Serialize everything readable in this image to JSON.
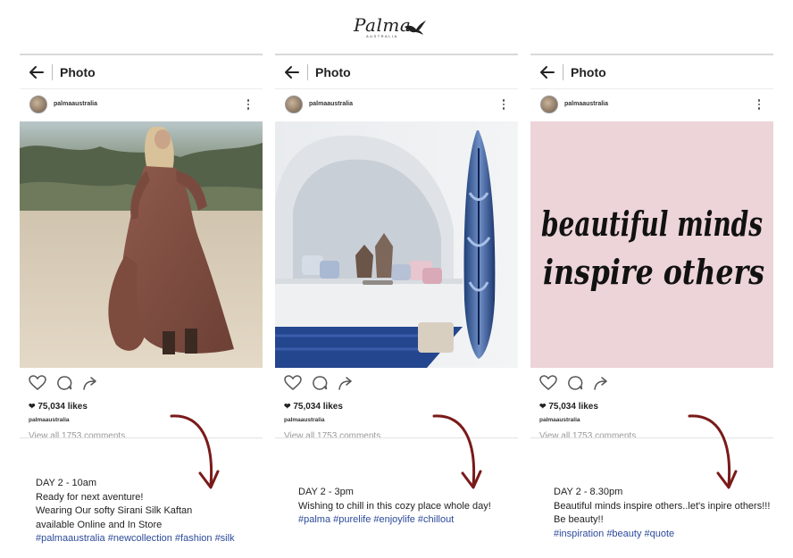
{
  "brand": {
    "logo_text": "Palma",
    "logo_sub": "AUSTRALIA"
  },
  "colors": {
    "arrow": "#7a1a1a",
    "hashtag": "#2c4a9a",
    "card_border": "#d9d9d9"
  },
  "posts": [
    {
      "header_title": "Photo",
      "username": "palmaaustralia",
      "likes": "75,034 likes",
      "poster": "palmaaustralia",
      "view_all": "View all 1753 comments",
      "photo_desc": "woman in flowing rust maxi kaftan dress on sandy beach",
      "caption": {
        "line1": "DAY 2 - 10am",
        "line2": "Ready for next aventure!",
        "line3": "Wearing Our softy Sirani Silk Kaftan",
        "line4": "available Online and In Store",
        "tags": "#palmaaustralia #newcollection #fashion #silk"
      }
    },
    {
      "header_title": "Photo",
      "username": "palmaaustralia",
      "likes": "75,034 likes",
      "poster": "palmaaustralia",
      "view_all": "View all 1753 comments",
      "photo_desc": "white arched nook with cushions, lanterns and a blue tie-dye surfboard",
      "caption": {
        "line1": "DAY 2 - 3pm",
        "line2": "Wishing to chill in this cozy place whole day!",
        "tags": "#palma #purelife #enjoylife #chillout"
      }
    },
    {
      "header_title": "Photo",
      "username": "palmaaustralia",
      "likes": "75,034 likes",
      "poster": "palmaaustralia",
      "view_all": "View all 1753 comments",
      "photo_quote_line1": "beautiful minds",
      "photo_quote_line2": "inspire others",
      "caption": {
        "line1": "DAY 2 - 8.30pm",
        "line2": "Beautiful minds inspire others..let's inpire others!!!",
        "line3": "Be beauty!!",
        "tags": "#inspiration #beauty #quote"
      }
    }
  ],
  "icons": [
    "back-arrow-icon",
    "more-vertical-icon",
    "heart-icon",
    "comment-icon",
    "share-icon",
    "home-icon",
    "search-icon",
    "camera-icon",
    "activity-heart-icon",
    "profile-avatar"
  ]
}
